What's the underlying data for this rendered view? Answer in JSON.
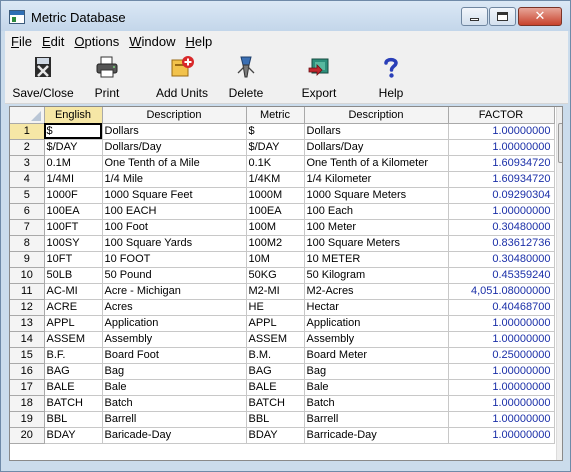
{
  "window": {
    "title": "Metric Database"
  },
  "menu": [
    {
      "key": "F",
      "rest": "ile"
    },
    {
      "key": "E",
      "rest": "dit"
    },
    {
      "key": "O",
      "rest": "ptions"
    },
    {
      "key": "W",
      "rest": "indow"
    },
    {
      "key": "H",
      "rest": "elp"
    }
  ],
  "toolbar": {
    "save_close": "Save/Close",
    "print": "Print",
    "add_units": "Add Units",
    "delete": "Delete",
    "export": "Export",
    "help": "Help"
  },
  "grid": {
    "columns": [
      "English",
      "Description",
      "Metric",
      "Description",
      "FACTOR"
    ],
    "rows": [
      {
        "n": "1",
        "english": "$",
        "edesc": "Dollars",
        "metric": "$",
        "mdesc": "Dollars",
        "factor": "1.00000000"
      },
      {
        "n": "2",
        "english": "$/DAY",
        "edesc": "Dollars/Day",
        "metric": "$/DAY",
        "mdesc": "Dollars/Day",
        "factor": "1.00000000"
      },
      {
        "n": "3",
        "english": "0.1M",
        "edesc": "One Tenth of a Mile",
        "metric": "0.1K",
        "mdesc": "One Tenth of a Kilometer",
        "factor": "1.60934720"
      },
      {
        "n": "4",
        "english": "1/4MI",
        "edesc": "1/4 Mile",
        "metric": "1/4KM",
        "mdesc": "1/4 Kilometer",
        "factor": "1.60934720"
      },
      {
        "n": "5",
        "english": "1000F",
        "edesc": "1000 Square Feet",
        "metric": "1000M",
        "mdesc": "1000 Square Meters",
        "factor": "0.09290304"
      },
      {
        "n": "6",
        "english": "100EA",
        "edesc": "100 EACH",
        "metric": "100EA",
        "mdesc": "100 Each",
        "factor": "1.00000000"
      },
      {
        "n": "7",
        "english": "100FT",
        "edesc": "100 Foot",
        "metric": "100M",
        "mdesc": "100 Meter",
        "factor": "0.30480000"
      },
      {
        "n": "8",
        "english": "100SY",
        "edesc": "100 Square Yards",
        "metric": "100M2",
        "mdesc": "100 Square Meters",
        "factor": "0.83612736"
      },
      {
        "n": "9",
        "english": "10FT",
        "edesc": "10 FOOT",
        "metric": "10M",
        "mdesc": "10 METER",
        "factor": "0.30480000"
      },
      {
        "n": "10",
        "english": "50LB",
        "edesc": "50 Pound",
        "metric": "50KG",
        "mdesc": "50 Kilogram",
        "factor": "0.45359240"
      },
      {
        "n": "11",
        "english": "AC-MI",
        "edesc": "Acre - Michigan",
        "metric": "M2-MI",
        "mdesc": "M2-Acres",
        "factor": "4,051.08000000"
      },
      {
        "n": "12",
        "english": "ACRE",
        "edesc": "Acres",
        "metric": "HE",
        "mdesc": "Hectar",
        "factor": "0.40468700"
      },
      {
        "n": "13",
        "english": "APPL",
        "edesc": "Application",
        "metric": "APPL",
        "mdesc": "Application",
        "factor": "1.00000000"
      },
      {
        "n": "14",
        "english": "ASSEM",
        "edesc": "Assembly",
        "metric": "ASSEM",
        "mdesc": "Assembly",
        "factor": "1.00000000"
      },
      {
        "n": "15",
        "english": "B.F.",
        "edesc": "Board Foot",
        "metric": "B.M.",
        "mdesc": "Board Meter",
        "factor": "0.25000000"
      },
      {
        "n": "16",
        "english": "BAG",
        "edesc": "Bag",
        "metric": "BAG",
        "mdesc": "Bag",
        "factor": "1.00000000"
      },
      {
        "n": "17",
        "english": "BALE",
        "edesc": "Bale",
        "metric": "BALE",
        "mdesc": "Bale",
        "factor": "1.00000000"
      },
      {
        "n": "18",
        "english": "BATCH",
        "edesc": "Batch",
        "metric": "BATCH",
        "mdesc": "Batch",
        "factor": "1.00000000"
      },
      {
        "n": "19",
        "english": "BBL",
        "edesc": "Barrell",
        "metric": "BBL",
        "mdesc": "Barrell",
        "factor": "1.00000000"
      },
      {
        "n": "20",
        "english": "BDAY",
        "edesc": "Baricade-Day",
        "metric": "BDAY",
        "mdesc": "Barricade-Day",
        "factor": "1.00000000"
      }
    ]
  },
  "colors": {
    "factor_text": "#1a2fa8",
    "active_header": "#f6e7a6"
  }
}
